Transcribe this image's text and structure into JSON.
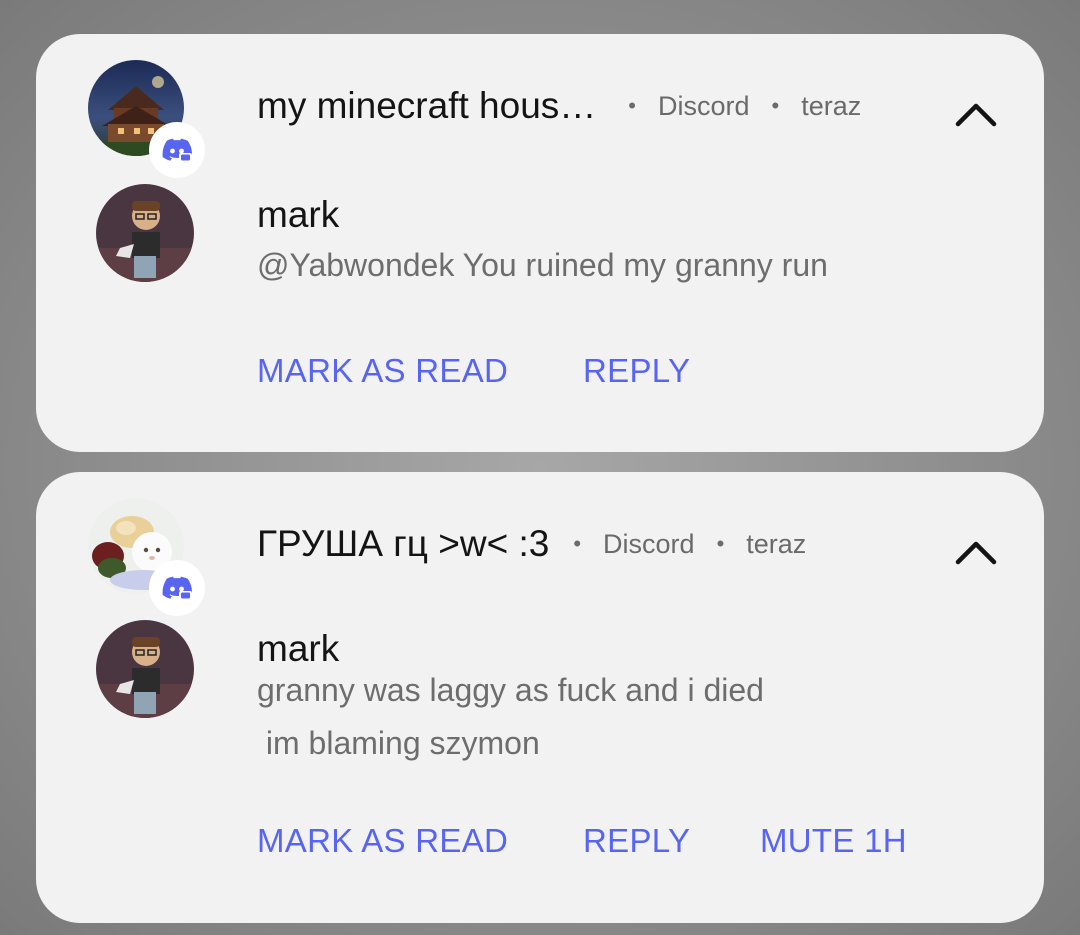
{
  "notifications": [
    {
      "group_title": "my minecraft hous…",
      "app_name": "Discord",
      "time": "teraz",
      "sender": "mark",
      "message_lines": [
        "@Yabwondek You ruined my granny run"
      ],
      "actions": [
        "MARK AS READ",
        "REPLY"
      ]
    },
    {
      "group_title": "ГРУША гц >w< :3",
      "app_name": "Discord",
      "time": "teraz",
      "sender": "mark",
      "message_lines": [
        "granny was laggy as fuck and i died",
        " im blaming szymon"
      ],
      "actions": [
        "MARK AS READ",
        "REPLY",
        "MUTE 1H"
      ]
    }
  ],
  "colors": {
    "accent": "#5865f2",
    "card_bg": "#f2f2f2",
    "primary_text": "#141414",
    "secondary_text": "#6d6d6d"
  },
  "icons": [
    "discord-icon",
    "chevron-up-icon"
  ]
}
